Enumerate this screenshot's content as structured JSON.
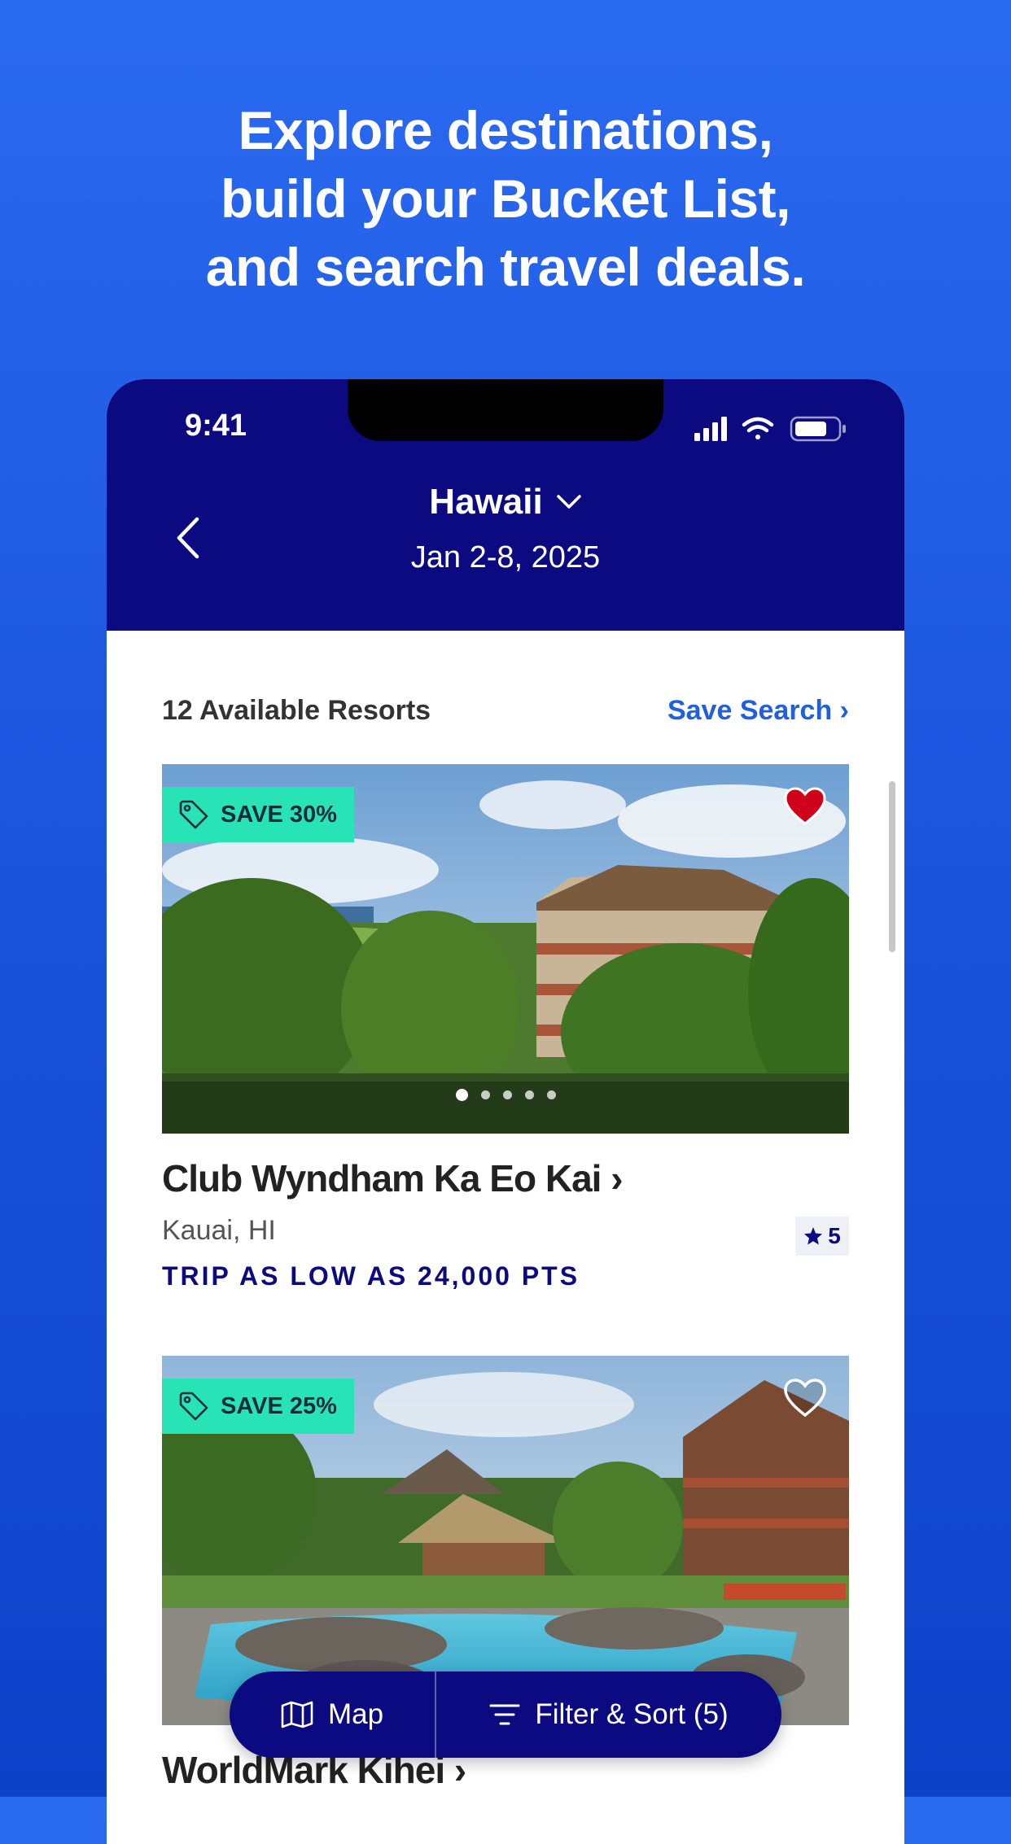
{
  "promo": {
    "headline_line1": "Explore destinations,",
    "headline_line2": "build your Bucket List,",
    "headline_line3": "and search travel deals."
  },
  "status_bar": {
    "time": "9:41"
  },
  "header": {
    "title": "Hawaii",
    "dates": "Jan 2-8, 2025"
  },
  "results": {
    "count_label": "12 Available Resorts",
    "save_search_label": "Save Search ›"
  },
  "resorts": [
    {
      "badge": "SAVE 30%",
      "name": "Club Wyndham Ka Eo Kai ›",
      "location": "Kauai, HI",
      "rating": "5",
      "price": "TRIP AS LOW AS 24,000 PTS",
      "favorited": true,
      "image_count": 5,
      "image_index": 1
    },
    {
      "badge": "SAVE 25%",
      "name": "WorldMark Kihei ›",
      "favorited": false
    }
  ],
  "bottom_bar": {
    "map_label": "Map",
    "filter_label": "Filter & Sort (5)"
  },
  "colors": {
    "brand_navy": "#0c0a80",
    "link_blue": "#1f5fe0",
    "badge_green": "#27e3b6",
    "favorite_red": "#d0021b"
  }
}
